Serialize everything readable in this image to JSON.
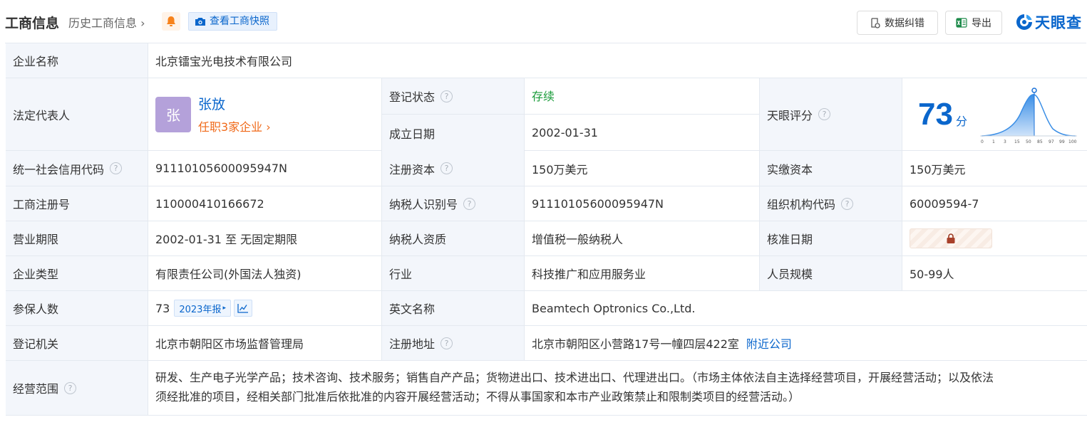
{
  "header": {
    "title": "工商信息",
    "history_link": "历史工商信息",
    "history_chevron": "›",
    "bell_icon": "bell-icon",
    "snapshot_label": "查看工商快照",
    "snapshot_icon": "camera-icon",
    "correct_label": "数据纠错",
    "export_label": "导出",
    "logo_text": "天眼查"
  },
  "colors": {
    "accent": "#0a66cc",
    "status_green": "#1a9b3a",
    "link_orange": "#f06a1a",
    "label_bg": "#f3f6fb",
    "avatar_bg": "#b4a1da"
  },
  "company_name": {
    "label": "企业名称",
    "value": "北京镭宝光电技术有限公司"
  },
  "legal_rep": {
    "label": "法定代表人",
    "avatar_char": "张",
    "name": "张放",
    "positions": "任职3家企业",
    "positions_chevron": "›"
  },
  "reg_status": {
    "label": "登记状态",
    "value": "存续"
  },
  "established": {
    "label": "成立日期",
    "value": "2002-01-31"
  },
  "tianyan_score": {
    "label": "天眼评分",
    "value": "73",
    "unit": "分",
    "axis_ticks": [
      "0",
      "1",
      "3",
      "15",
      "50",
      "85",
      "97",
      "99",
      "100"
    ]
  },
  "credit_code": {
    "label": "统一社会信用代码",
    "value": "91110105600095947N"
  },
  "reg_capital": {
    "label": "注册资本",
    "value": "150万美元"
  },
  "paid_capital": {
    "label": "实缴资本",
    "value": "150万美元"
  },
  "reg_number": {
    "label": "工商注册号",
    "value": "110000410166672"
  },
  "taxpayer_id": {
    "label": "纳税人识别号",
    "value": "91110105600095947N"
  },
  "org_code": {
    "label": "组织机构代码",
    "value": "60009594-7"
  },
  "business_term": {
    "label": "营业期限",
    "value": "2002-01-31 至 无固定期限"
  },
  "taxpayer_qual": {
    "label": "纳税人资质",
    "value": "增值税一般纳税人"
  },
  "approval_date": {
    "label": "核准日期",
    "value_icon": "lock-icon"
  },
  "company_type": {
    "label": "企业类型",
    "value": "有限责任公司(外国法人独资)"
  },
  "industry": {
    "label": "行业",
    "value": "科技推广和应用服务业"
  },
  "staff_size": {
    "label": "人员规模",
    "value": "50-99人"
  },
  "insured": {
    "label": "参保人数",
    "value": "73",
    "report_badge": "2023年报",
    "report_chevron": "▸",
    "trend_icon": "trend-chart-icon"
  },
  "english_name": {
    "label": "英文名称",
    "value": "Beamtech Optronics Co.,Ltd."
  },
  "reg_authority": {
    "label": "登记机关",
    "value": "北京市朝阳区市场监督管理局"
  },
  "reg_address": {
    "label": "注册地址",
    "value": "北京市朝阳区小营路17号一幢四层422室",
    "nearby_link": "附近公司"
  },
  "business_scope": {
    "label": "经营范围",
    "line1": "研发、生产电子光学产品；技术咨询、技术服务；销售自产产品；货物进出口、技术进出口、代理进出口。（市场主体依法自主选择经营项目，开展经营活动；以及依法",
    "line2": "须经批准的项目，经相关部门批准后依批准的内容开展经营活动；不得从事国家和本市产业政策禁止和限制类项目的经营活动。）"
  },
  "help_glyph": "?"
}
